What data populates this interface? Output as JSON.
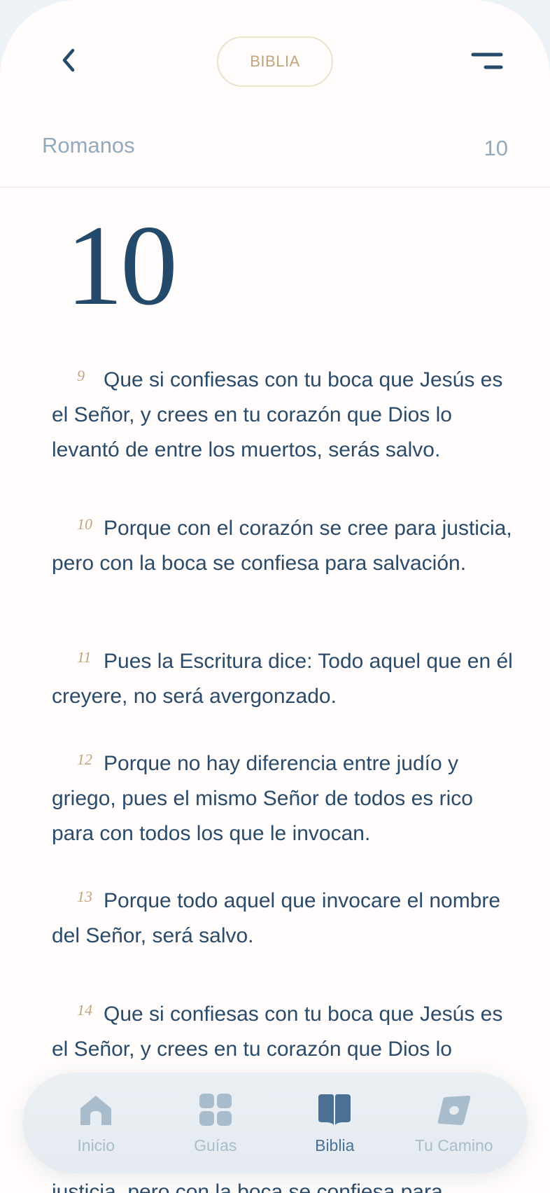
{
  "header": {
    "pill_label": "BIBLIA",
    "book": "Romanos",
    "chapter_small": "10"
  },
  "chapter_big": "10",
  "verses": [
    {
      "num": "9",
      "text": "Que si confiesas con tu boca que Jesús es el Señor, y crees en tu corazón que Dios lo levantó de entre los muertos, serás salvo."
    },
    {
      "num": "10",
      "text": "Porque con el corazón se cree para justicia, pero con la boca se confiesa para salvación."
    },
    {
      "num": "11",
      "text": "Pues la Escritura dice: Todo aquel que en él creyere, no será avergonzado."
    },
    {
      "num": "12",
      "text": "Porque no hay diferencia entre judío y griego, pues el mismo Señor de todos es rico para con todos los que le invocan."
    },
    {
      "num": "13",
      "text": "Porque todo aquel que invocare el nombre del Señor, será salvo."
    },
    {
      "num": "14",
      "text": "Que si confiesas con tu boca que Jesús es el Señor, y crees en tu corazón que Dios lo"
    }
  ],
  "below_nav_text": "justicia, pero con la boca se confiesa para",
  "nav": {
    "items": [
      {
        "label": "Inicio",
        "icon": "home-icon"
      },
      {
        "label": "Guías",
        "icon": "grid-icon"
      },
      {
        "label": "Biblia",
        "icon": "book-icon",
        "active": true
      },
      {
        "label": "Tu Camino",
        "icon": "compass-icon"
      }
    ]
  },
  "colors": {
    "navy": "#234a6a",
    "gold": "#c1a47c",
    "muted": "#93a9bc",
    "active_nav": "#4a7194"
  }
}
